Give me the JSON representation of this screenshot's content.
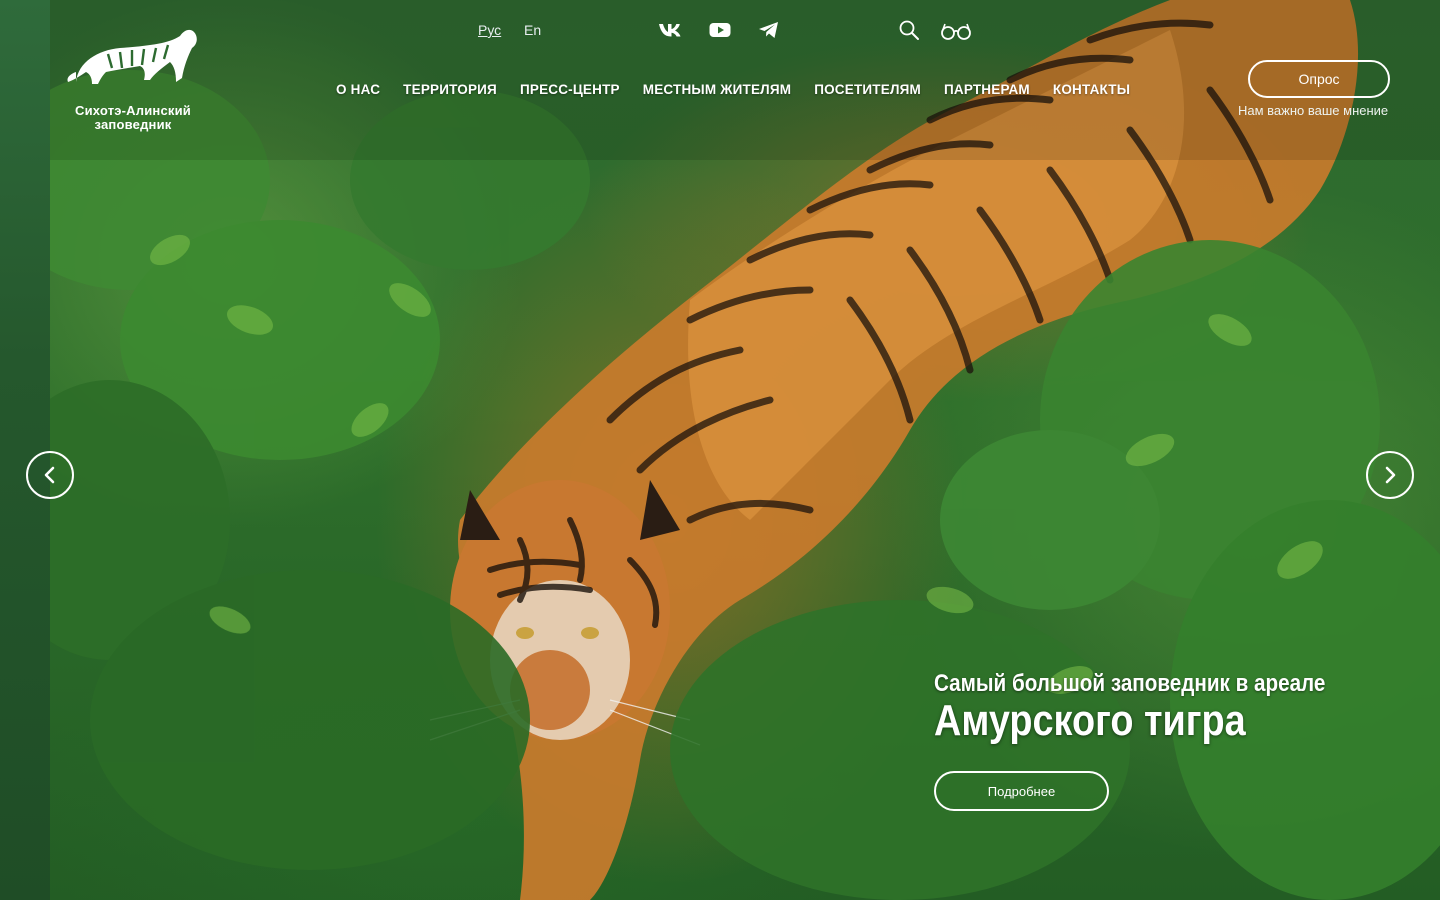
{
  "brand": {
    "name_line1": "Сихотэ-Алинский",
    "name_line2": "заповедник"
  },
  "languages": [
    {
      "label": "Рус",
      "active": true
    },
    {
      "label": "En",
      "active": false
    }
  ],
  "social": [
    "vk-icon",
    "youtube-icon",
    "telegram-icon"
  ],
  "utilities": [
    "search-icon",
    "accessibility-glasses-icon"
  ],
  "nav": [
    "О НАС",
    "ТЕРРИТОРИЯ",
    "ПРЕСС-ЦЕНТР",
    "МЕСТНЫМ ЖИТЕЛЯМ",
    "ПОСЕТИТЕЛЯМ",
    "ПАРТНЕРАМ",
    "КОНТАКТЫ"
  ],
  "survey": {
    "button": "Опрос",
    "note": "Нам важно ваше мнение"
  },
  "hero": {
    "subtitle": "Самый большой заповедник в ареале",
    "title": "Амурского тигра",
    "button": "Подробнее"
  },
  "colors": {
    "side_strip": "#2f6b3b",
    "foliage": "#2e6f2b",
    "tiger_orange": "#c77a2e"
  }
}
